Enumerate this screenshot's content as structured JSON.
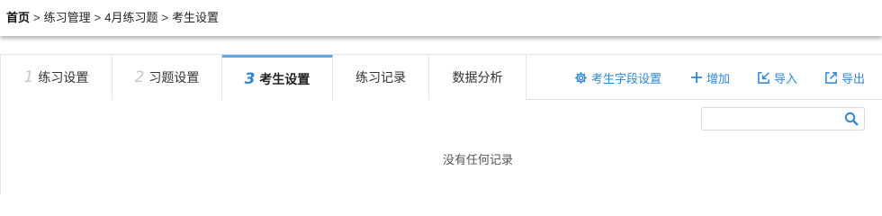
{
  "breadcrumb": {
    "home": "首页",
    "items": [
      "练习管理",
      "4月练习题",
      "考生设置"
    ],
    "separator": ">"
  },
  "tabs": [
    {
      "num": "1",
      "label": "练习设置",
      "active": false
    },
    {
      "num": "2",
      "label": "习题设置",
      "active": false
    },
    {
      "num": "3",
      "label": "考生设置",
      "active": true
    },
    {
      "num": "",
      "label": "练习记录",
      "active": false
    },
    {
      "num": "",
      "label": "数据分析",
      "active": false
    }
  ],
  "actions": {
    "field_settings": "考生字段设置",
    "add": "增加",
    "import": "导入",
    "export": "导出"
  },
  "search": {
    "value": "",
    "placeholder": ""
  },
  "empty_message": "没有任何记录",
  "colors": {
    "accent": "#2f86d6",
    "active_tab_border": "#5aa7e8",
    "inactive_number": "#c8c8c8"
  }
}
